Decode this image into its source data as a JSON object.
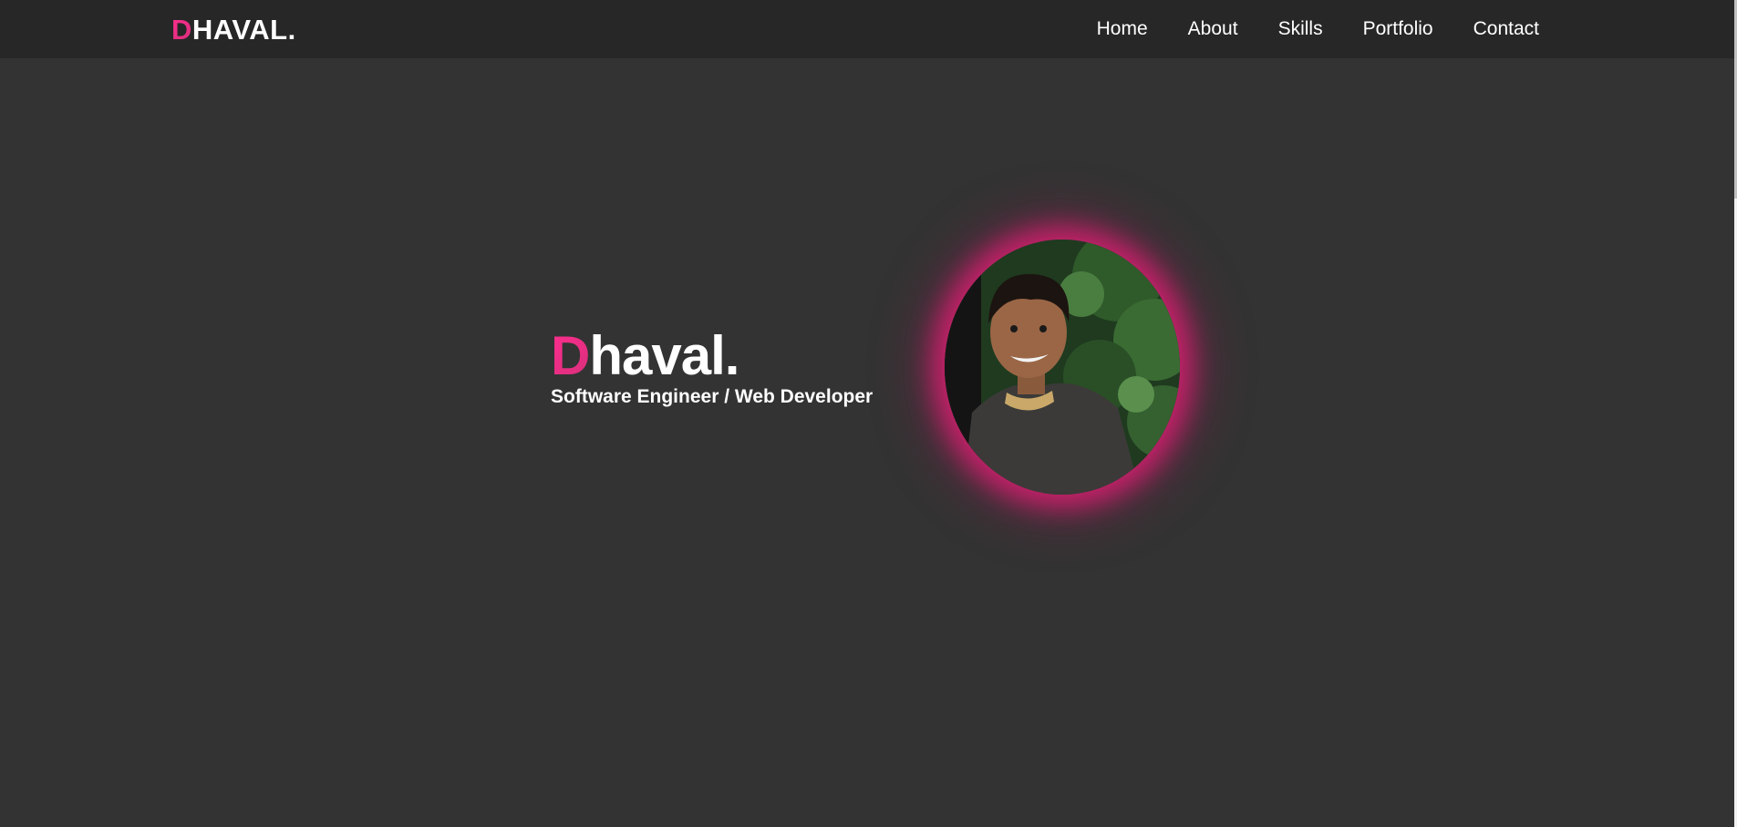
{
  "brand": {
    "initial": "D",
    "rest": "HAVAL."
  },
  "nav": {
    "items": [
      {
        "label": "Home"
      },
      {
        "label": "About"
      },
      {
        "label": "Skills"
      },
      {
        "label": "Portfolio"
      },
      {
        "label": "Contact"
      }
    ]
  },
  "hero": {
    "name_initial": "D",
    "name_rest": "haval.",
    "role": "Software Engineer / Web Developer"
  },
  "colors": {
    "background": "#333333",
    "navbar": "#272727",
    "accent": "#ff2d8f",
    "text": "#ffffff"
  }
}
